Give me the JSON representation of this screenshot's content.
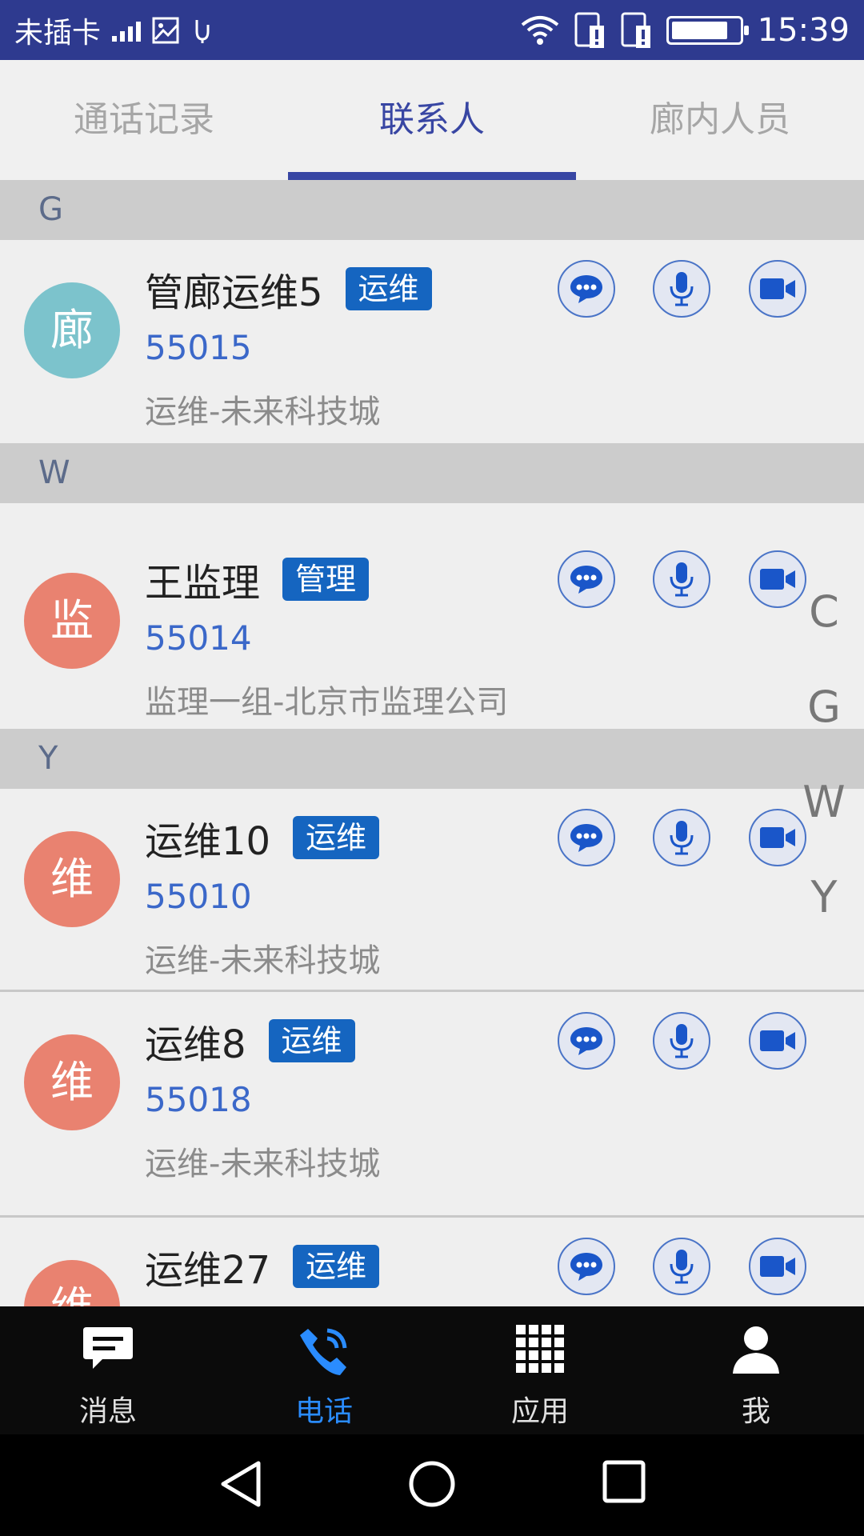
{
  "status_bar": {
    "carrier": "未插卡",
    "time": "15:39",
    "battery_level": 0.85
  },
  "tabs": [
    {
      "label": "通话记录",
      "active": false
    },
    {
      "label": "联系人",
      "active": true
    },
    {
      "label": "廊内人员",
      "active": false
    }
  ],
  "sections": [
    {
      "letter": "G",
      "contacts": [
        {
          "avatar": "廊",
          "avatar_color": "#7cc3cc",
          "name": "管廊运维5",
          "tag": "运维",
          "number": "55015",
          "department": "运维-未来科技城"
        }
      ]
    },
    {
      "letter": "W",
      "contacts": [
        {
          "avatar": "监",
          "avatar_color": "#e98270",
          "name": "王监理",
          "tag": "管理",
          "number": "55014",
          "department": "监理一组-北京市监理公司"
        }
      ]
    },
    {
      "letter": "Y",
      "contacts": [
        {
          "avatar": "维",
          "avatar_color": "#e98270",
          "name": "运维10",
          "tag": "运维",
          "number": "55010",
          "department": "运维-未来科技城"
        },
        {
          "avatar": "维",
          "avatar_color": "#e98270",
          "name": "运维8",
          "tag": "运维",
          "number": "55018",
          "department": "运维-未来科技城"
        },
        {
          "avatar": "维",
          "avatar_color": "#e98270",
          "name": "运维27",
          "tag": "运维",
          "number": "",
          "department": ""
        }
      ]
    }
  ],
  "alphabet_index": [
    "C",
    "G",
    "W",
    "Y"
  ],
  "contact_actions": [
    {
      "icon": "chat-bubble-icon"
    },
    {
      "icon": "microphone-icon"
    },
    {
      "icon": "video-camera-icon"
    }
  ],
  "bottom_nav": [
    {
      "label": "消息",
      "icon": "message-icon",
      "active": false
    },
    {
      "label": "电话",
      "icon": "phone-icon",
      "active": true
    },
    {
      "label": "应用",
      "icon": "apps-grid-icon",
      "active": false
    },
    {
      "label": "我",
      "icon": "person-icon",
      "active": false
    }
  ],
  "colors": {
    "status_bar": "#2e3a8f",
    "accent": "#3846a3",
    "tag": "#1565c0",
    "number": "#3b68c9",
    "nav_active": "#2a8cff"
  }
}
